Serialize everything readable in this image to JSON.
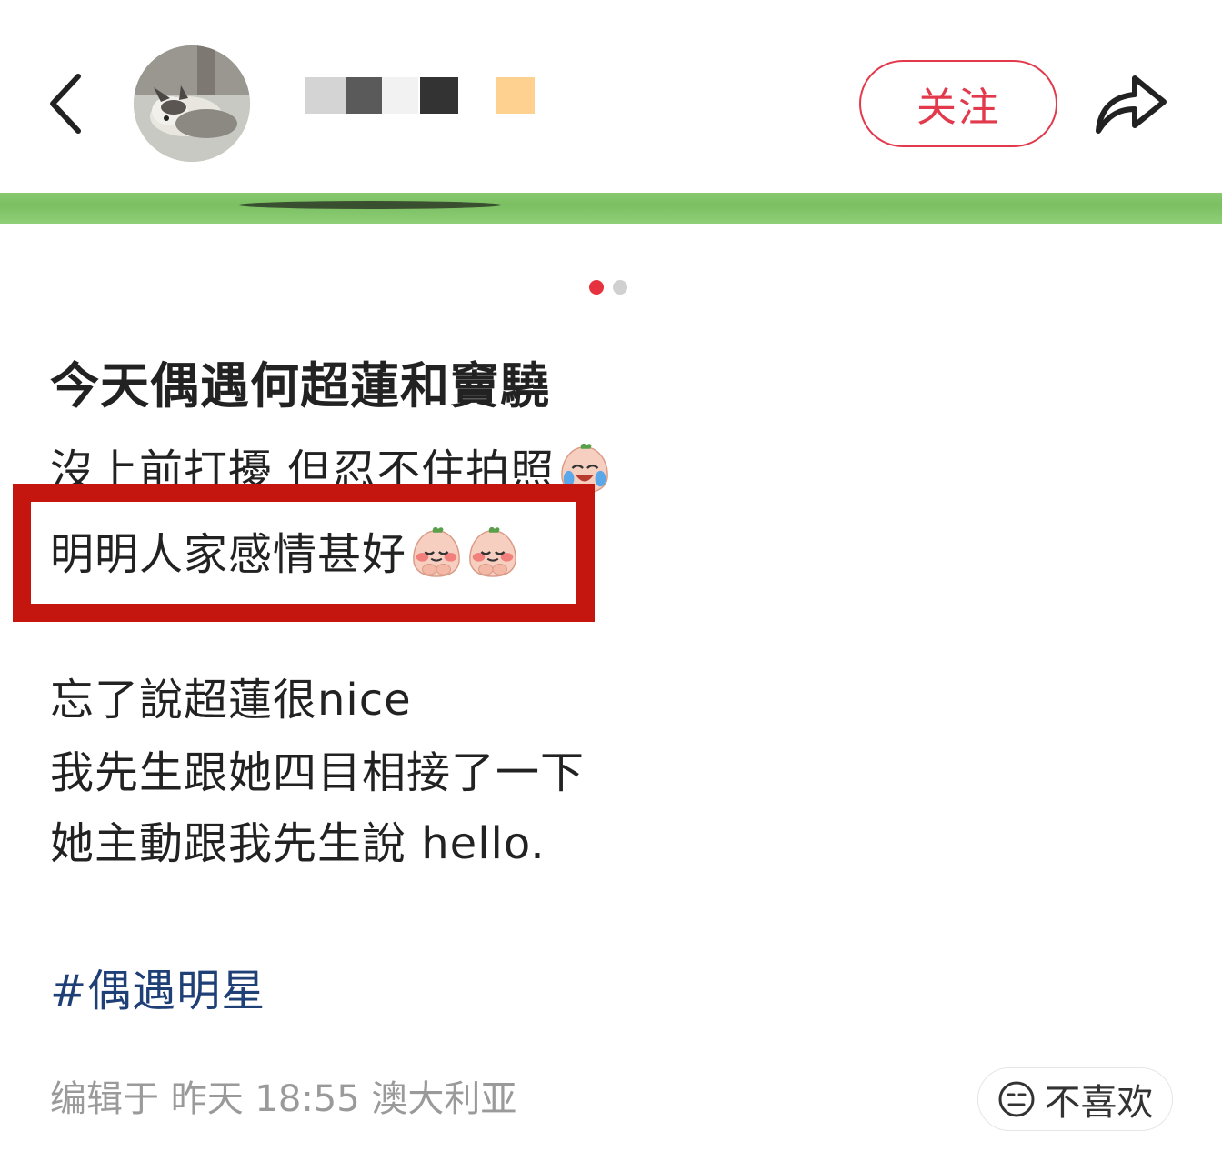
{
  "header": {
    "back_icon": "chevron-left-icon",
    "avatar": "husky-dog-avatar",
    "follow_label": "关注",
    "share_icon": "share-arrow-icon",
    "accent_color": "#e23a4c"
  },
  "carousel": {
    "page_count": 2,
    "active_index": 0,
    "active_color": "#e5323e",
    "inactive_color": "#d0d0d0"
  },
  "post": {
    "title": "今天偶遇何超蓮和竇驍",
    "line1": "沒上前打擾 但忍不住拍照",
    "line2": "明明人家感情甚好",
    "line3": "忘了說超蓮很nice",
    "line4": "我先生跟她四目相接了一下",
    "line5": "她主動跟我先生說 hello.",
    "hashtag": "#偶遇明星",
    "hashtag_color": "#1f3f77",
    "emojis": [
      "crying-laughing-peach-emoji",
      "blushing-peach-emoji",
      "blushing-peach-emoji"
    ]
  },
  "footer": {
    "edited_text": "编辑于 昨天 18:55 澳大利亚",
    "dislike_label": "不喜欢",
    "dislike_icon": "neutral-face-icon"
  },
  "annotation": {
    "box_color": "#c4160f"
  }
}
